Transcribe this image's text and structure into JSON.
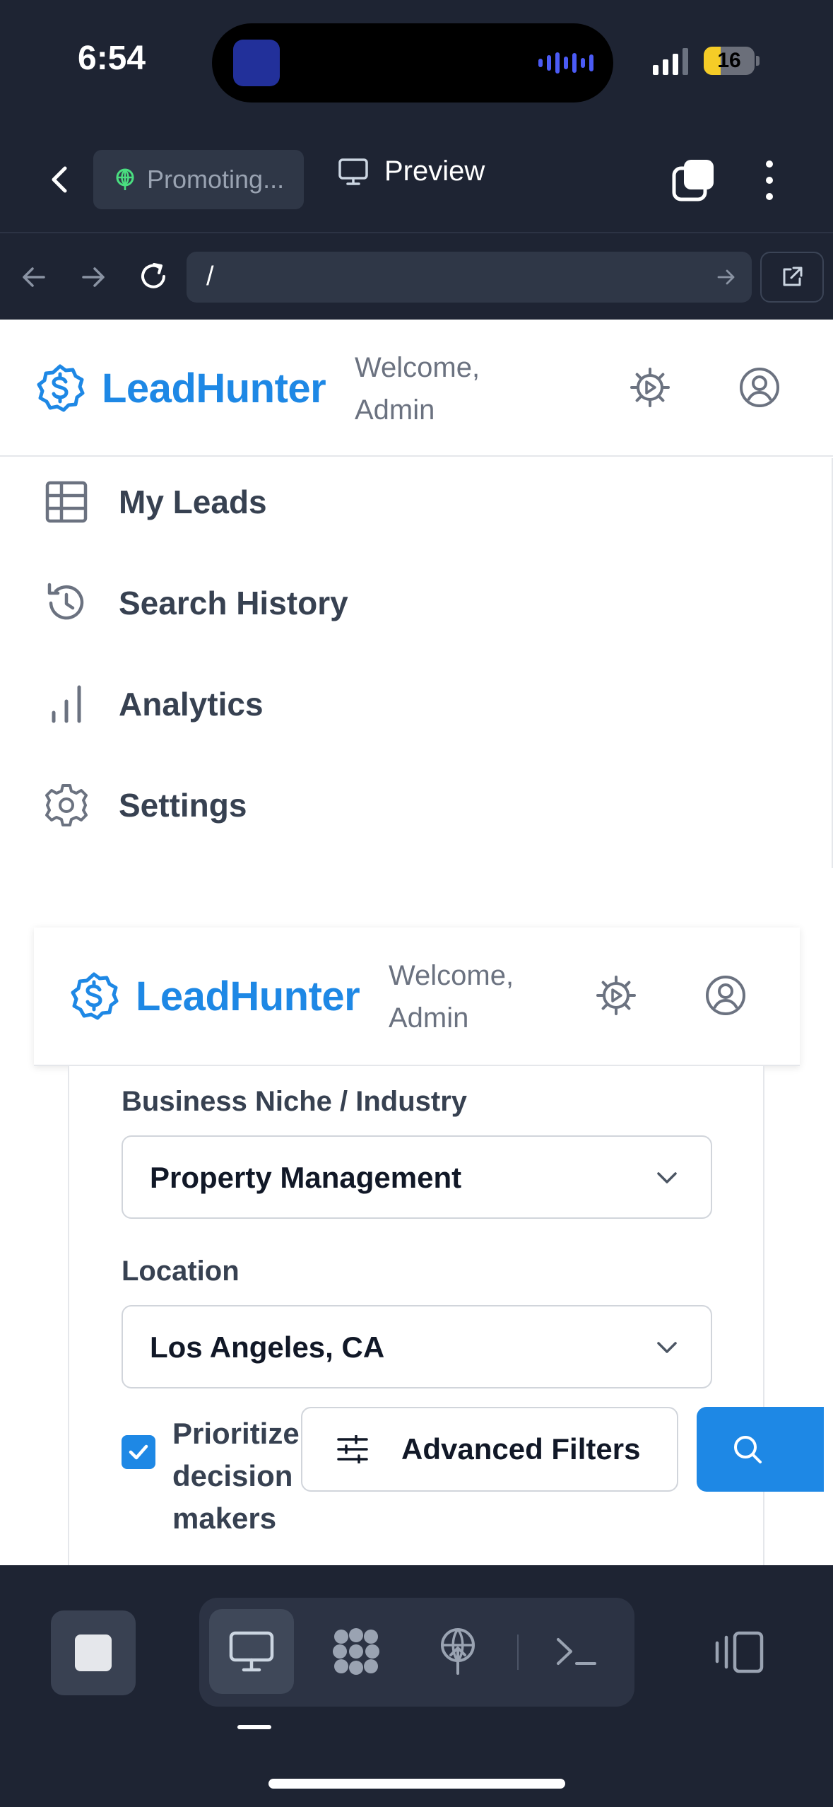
{
  "status_bar": {
    "time": "6:54",
    "battery": "16",
    "battery_level_pct": 16
  },
  "toolbar": {
    "project_pill": "Promoting...",
    "preview_label": "Preview"
  },
  "url_bar": {
    "url": "/"
  },
  "site": {
    "brand": "LeadHunter",
    "welcome": "Welcome, Admin",
    "brand_color": "#1e88e5"
  },
  "menu": {
    "items": [
      {
        "label": "My Leads",
        "icon": "table-icon"
      },
      {
        "label": "Search History",
        "icon": "history-icon"
      },
      {
        "label": "Analytics",
        "icon": "bar-chart-icon"
      },
      {
        "label": "Settings",
        "icon": "gear-icon"
      }
    ]
  },
  "form": {
    "niche_label": "Business Niche / Industry",
    "niche_value": "Property Management",
    "location_label": "Location",
    "location_value": "Los Angeles, CA",
    "prioritize_label": "Prioritize decision makers",
    "prioritize_checked": true,
    "advanced_filters_label": "Advanced Filters"
  },
  "dock": {
    "modes": [
      "desktop-icon",
      "apps-icon",
      "deploy-icon",
      "terminal-icon"
    ],
    "active_mode": "desktop-icon"
  }
}
